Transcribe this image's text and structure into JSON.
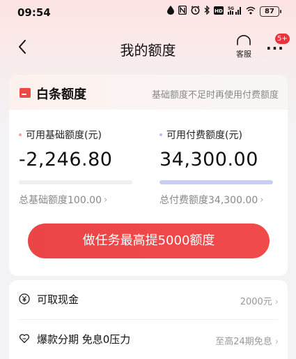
{
  "status": {
    "time": "09:54",
    "battery": "87"
  },
  "nav": {
    "title": "我的额度",
    "service_label": "客服",
    "more_badge": "5+"
  },
  "card": {
    "title": "白条额度",
    "note": "基础额度不足时再使用付费额度",
    "basic": {
      "label": "可用基础额度(元)",
      "value": "-2,246.80",
      "total": "总基础额度100.00",
      "used_fraction": 0
    },
    "paid": {
      "label": "可用付费额度(元)",
      "value": "34,300.00",
      "total": "总付费额度34,300.00",
      "used_fraction": 1
    },
    "cta_label": "做任务最高提5000额度"
  },
  "list": [
    {
      "icon": "yen-circle-icon",
      "label": "可取现金",
      "value": "2000元"
    },
    {
      "icon": "heart-icon",
      "label": "爆款分期 免息0压力",
      "value": "至高24期免息"
    }
  ],
  "colors": {
    "accent": "#ec4547",
    "paid_bar": "#c7cef2",
    "basic_dot": "#f3a3a3",
    "paid_dot": "#b5bde8"
  }
}
